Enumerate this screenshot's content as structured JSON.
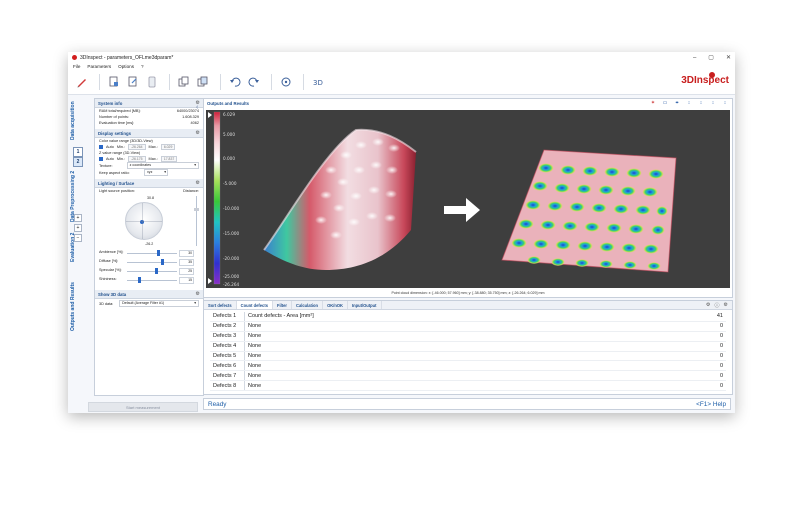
{
  "window": {
    "title": "3DInspect - parameters_OFLme3dparam*",
    "controls": [
      "–",
      "▢",
      "✕"
    ]
  },
  "menu": [
    "File",
    "Parameters",
    "Options",
    "?"
  ],
  "brand": "3DInspect",
  "steps": {
    "tabs": [
      {
        "label": "Data acquisition"
      },
      {
        "label": "Data Preprocessing 2"
      },
      {
        "label": "Evaluation 2"
      },
      {
        "label": "Outputs and Results"
      }
    ],
    "numbers": [
      "1",
      "2"
    ]
  },
  "system_info": {
    "title": "System info",
    "rows": [
      {
        "label": "RAM total/required [MB]:",
        "value": "64000/23074"
      },
      {
        "label": "Number of points:",
        "value": "1.608.329"
      },
      {
        "label": "Evaluation time [ms]:",
        "value": "4062"
      }
    ]
  },
  "display_settings": {
    "title": "Display settings",
    "color_range_label": "Color value range (3D/3D-View)",
    "auto_label": "Auto",
    "min_label": "Min.:",
    "max_label": "Max.:",
    "color_min": "-26.264",
    "color_max": "6.029",
    "z_range_label": "Z value range (3D-View)",
    "z_min": "-26.175",
    "z_max": "17.837",
    "texture_label": "Texture:",
    "texture_value": "z coordinates",
    "aspect_label": "Keep aspect ratio:",
    "aspect_value": "xyz"
  },
  "lighting": {
    "title": "Lighting / Surface",
    "light_pos_label": "Light source position:",
    "distance_label": "Distance:",
    "top_value": "30.8",
    "bottom_value": "-26.2",
    "sliders": [
      {
        "label": "Ambience [%]:",
        "value": "30",
        "pos": 0.62
      },
      {
        "label": "Diffuse [%]:",
        "value": "35",
        "pos": 0.7
      },
      {
        "label": "Specular [%]:",
        "value": "25",
        "pos": 0.58
      },
      {
        "label": "Shininess:",
        "value": "15",
        "pos": 0.25
      }
    ]
  },
  "show3d": {
    "title": "Show 3D data",
    "label": "3D data:",
    "value": "Default (Average Filter #1)"
  },
  "start_button": "Start measurement",
  "viewer": {
    "title": "Outputs and Results",
    "tools": [
      "✶",
      "▭",
      "⌖",
      "↕",
      "↕",
      "↕",
      "↕"
    ],
    "dims": "Point cloud dimension:   x: [-46.000; 57.960] mm;   y: [-38.880; 35.750] mm;   z: [-26.264; 6.029] mm"
  },
  "colorbar": {
    "labels": [
      "6.029",
      "5.000",
      "0.000",
      "-5.000",
      "-10.000",
      "-15.000",
      "-20.000",
      "-25.000",
      "-26.264"
    ],
    "colors": [
      "#d0203a",
      "#e89aa6",
      "#f3c0c8",
      "#ffffff",
      "#a7e05a",
      "#38c838",
      "#1fc4c4",
      "#2a7fe0",
      "#3030d0",
      "#8a2ec8"
    ]
  },
  "result_tabs": [
    "Sort defects",
    "Count defects",
    "Filter",
    "Calculation",
    "OK/nOK",
    "Input/Output"
  ],
  "defects": [
    {
      "name": "Defects 1",
      "desc": "Count defects - Area [mm²]",
      "value": "41"
    },
    {
      "name": "Defects 2",
      "desc": "None",
      "value": "0"
    },
    {
      "name": "Defects 3",
      "desc": "None",
      "value": "0"
    },
    {
      "name": "Defects 4",
      "desc": "None",
      "value": "0"
    },
    {
      "name": "Defects 5",
      "desc": "None",
      "value": "0"
    },
    {
      "name": "Defects 6",
      "desc": "None",
      "value": "0"
    },
    {
      "name": "Defects 7",
      "desc": "None",
      "value": "0"
    },
    {
      "name": "Defects 8",
      "desc": "None",
      "value": "0"
    }
  ],
  "status": {
    "text": "Ready",
    "help": "<F1> Help"
  },
  "colors": {
    "accent": "#1f5fa8",
    "brand": "#c81e1e"
  }
}
